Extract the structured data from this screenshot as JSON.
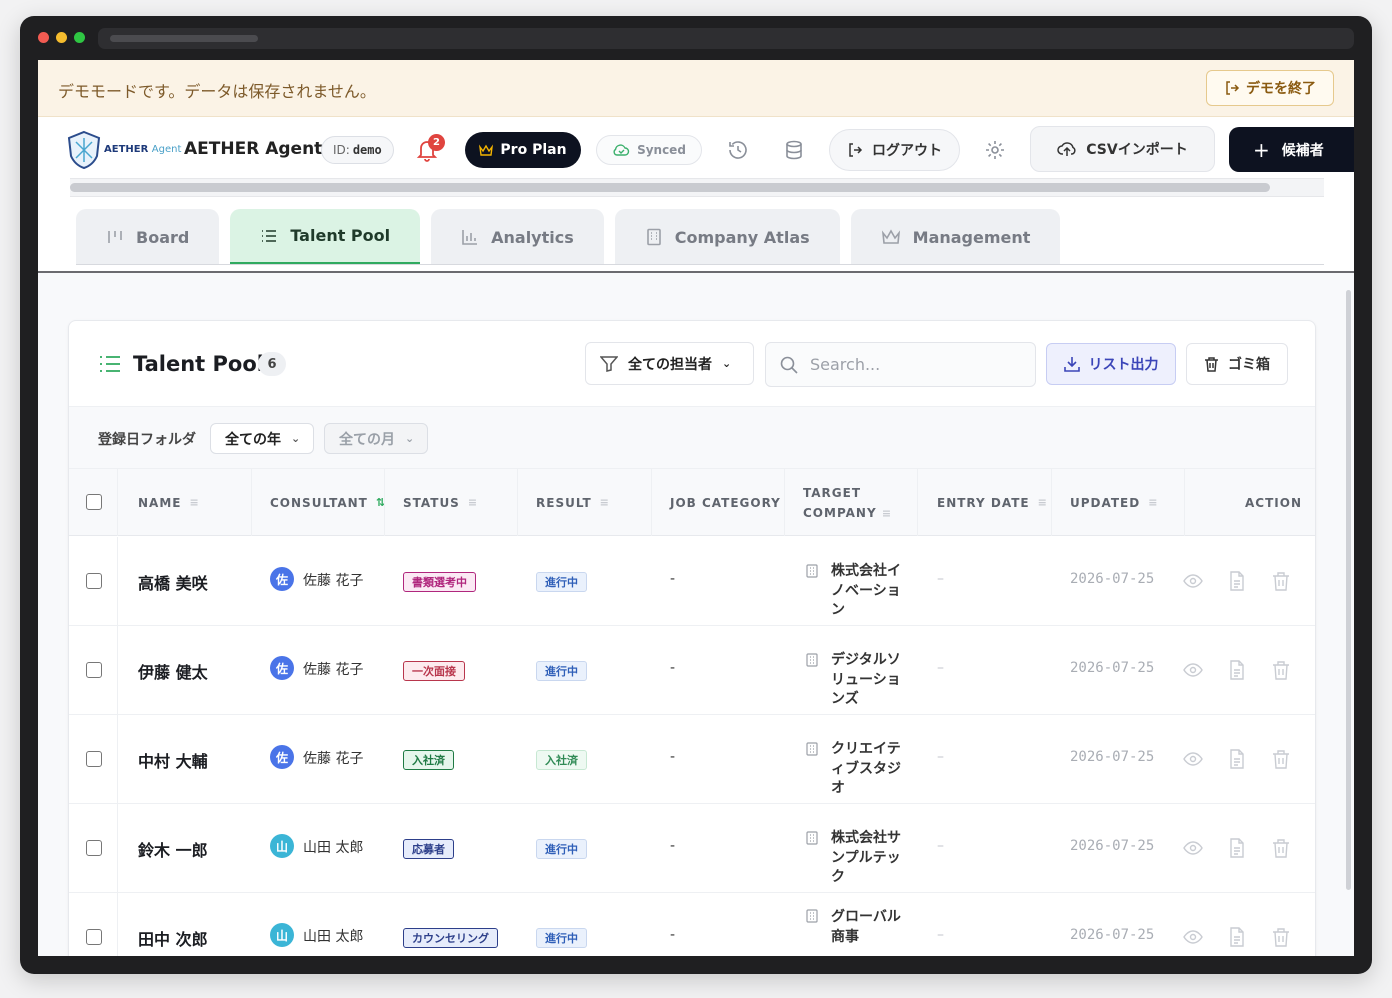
{
  "banner": {
    "text": "デモモードです。データは保存されません。",
    "exit_label": "デモを終了"
  },
  "header": {
    "logo_main": "AETHER",
    "logo_sub": "Agent",
    "app_name": "AETHER Agent",
    "id_label": "ID:",
    "id_value": "demo",
    "notification_count": "2",
    "plan_label": "Pro Plan",
    "sync_label": "Synced",
    "logout_label": "ログアウト",
    "csv_label": "CSVインポート",
    "add_label": "候補者"
  },
  "tabs": [
    {
      "label": "Board",
      "icon": "board-icon"
    },
    {
      "label": "Talent Pool",
      "icon": "list-icon",
      "active": true
    },
    {
      "label": "Analytics",
      "icon": "bar-chart-icon"
    },
    {
      "label": "Company Atlas",
      "icon": "building-icon"
    },
    {
      "label": "Management",
      "icon": "crown-icon"
    }
  ],
  "pool": {
    "title": "Talent Pool",
    "count": "6",
    "assignee_filter": "全ての担当者",
    "search_placeholder": "Search...",
    "export_label": "リスト出力",
    "trash_label": "ゴミ箱",
    "folder_label": "登録日フォルダ",
    "year_select": "全ての年",
    "month_select": "全ての月"
  },
  "columns": {
    "name": "NAME",
    "consultant": "CONSULTANT",
    "status": "STATUS",
    "result": "RESULT",
    "job_category": "JOB CATEGORY",
    "target_company_1": "TARGET",
    "target_company_2": "COMPANY",
    "entry_date": "ENTRY DATE",
    "updated": "UPDATED",
    "action": "ACTION"
  },
  "rows": [
    {
      "name": "高橋 美咲",
      "avatar": "佐",
      "avatar_color": "#4a74e8",
      "consultant": "佐藤 花子",
      "status": "書類選考中",
      "status_color": "#b0267d",
      "status_bg": "#fbe9f4",
      "result": "進行中",
      "result_color": "#2f5fb8",
      "result_bg": "#eaf1fc",
      "job_category": "-",
      "company": "株式会社イノベーション",
      "entry_date": "–",
      "updated": "2026-07-25"
    },
    {
      "name": "伊藤 健太",
      "avatar": "佐",
      "avatar_color": "#4a74e8",
      "consultant": "佐藤 花子",
      "status": "一次面接",
      "status_color": "#b8364c",
      "status_bg": "#fdebee",
      "result": "進行中",
      "result_color": "#2f5fb8",
      "result_bg": "#eaf1fc",
      "job_category": "-",
      "company": "デジタルソリューションズ",
      "entry_date": "–",
      "updated": "2026-07-25"
    },
    {
      "name": "中村 大輔",
      "avatar": "佐",
      "avatar_color": "#4a74e8",
      "consultant": "佐藤 花子",
      "status": "入社済",
      "status_color": "#1f7a44",
      "status_bg": "#e6f6ec",
      "result": "入社済",
      "result_color": "#2f8a55",
      "result_bg": "#eef9f2",
      "job_category": "-",
      "company": "クリエイティブスタジオ",
      "entry_date": "–",
      "updated": "2026-07-25"
    },
    {
      "name": "鈴木 一郎",
      "avatar": "山",
      "avatar_color": "#3bb5d6",
      "consultant": "山田 太郎",
      "status": "応募者",
      "status_color": "#2d3f8a",
      "status_bg": "#e6ecfb",
      "result": "進行中",
      "result_color": "#2f5fb8",
      "result_bg": "#eaf1fc",
      "job_category": "-",
      "company": "株式会社サンプルテック",
      "entry_date": "–",
      "updated": "2026-07-25"
    },
    {
      "name": "田中 次郎",
      "avatar": "山",
      "avatar_color": "#3bb5d6",
      "consultant": "山田 太郎",
      "status": "カウンセリング",
      "status_color": "#2d3f8a",
      "status_bg": "#e6ecfb",
      "result": "進行中",
      "result_color": "#2f5fb8",
      "result_bg": "#eaf1fc",
      "job_category": "-",
      "company": "グローバル商事",
      "entry_date": "–",
      "updated": "2026-07-25"
    }
  ]
}
